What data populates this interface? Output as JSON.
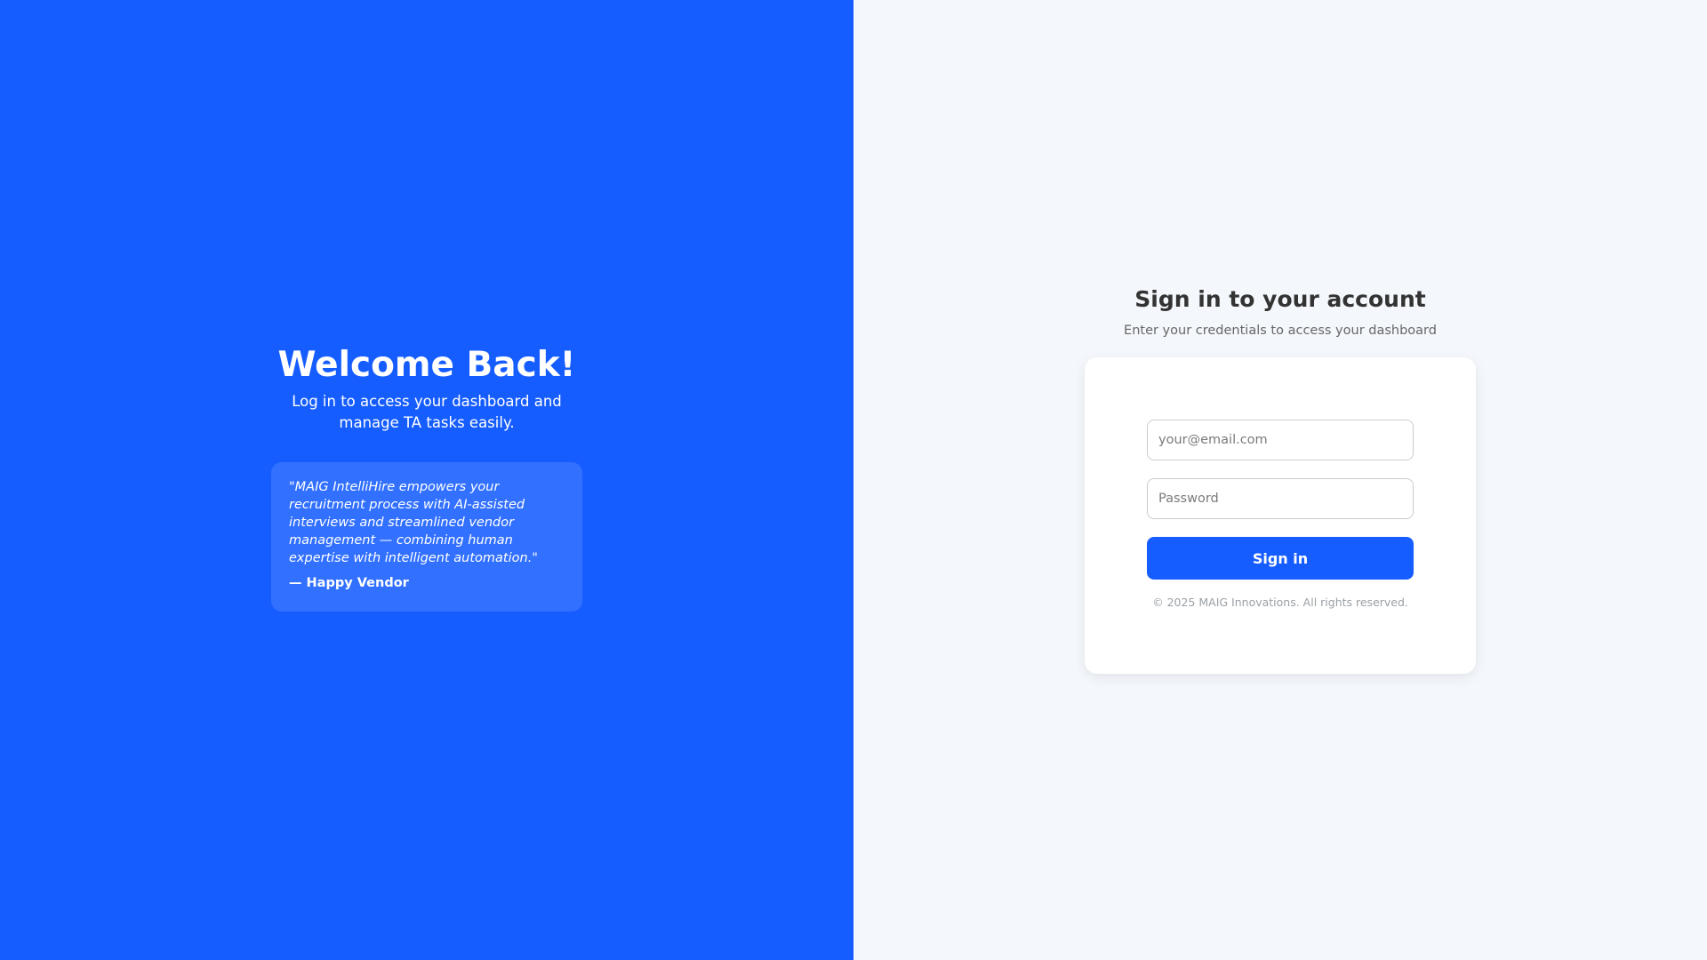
{
  "hero": {
    "title": "Welcome Back!",
    "subtitle": "Log in to access your dashboard and manage TA tasks easily."
  },
  "testimonial": {
    "quote": "\"MAIG IntelliHire empowers your recruitment process with AI-assisted interviews and streamlined vendor management — combining human expertise with intelligent automation.\"",
    "author": "— Happy Vendor"
  },
  "login": {
    "title": "Sign in to your account",
    "subtitle": "Enter your credentials to access your dashboard",
    "email": {
      "value": "",
      "placeholder": "your@email.com"
    },
    "password": {
      "value": "",
      "placeholder": "Password"
    },
    "submit_label": "Sign in",
    "copyright": "© 2025 MAIG Innovations. All rights reserved."
  },
  "colors": {
    "brand_blue": "#165dff",
    "right_background": "#f4f7fb",
    "card_background": "#ffffff"
  }
}
